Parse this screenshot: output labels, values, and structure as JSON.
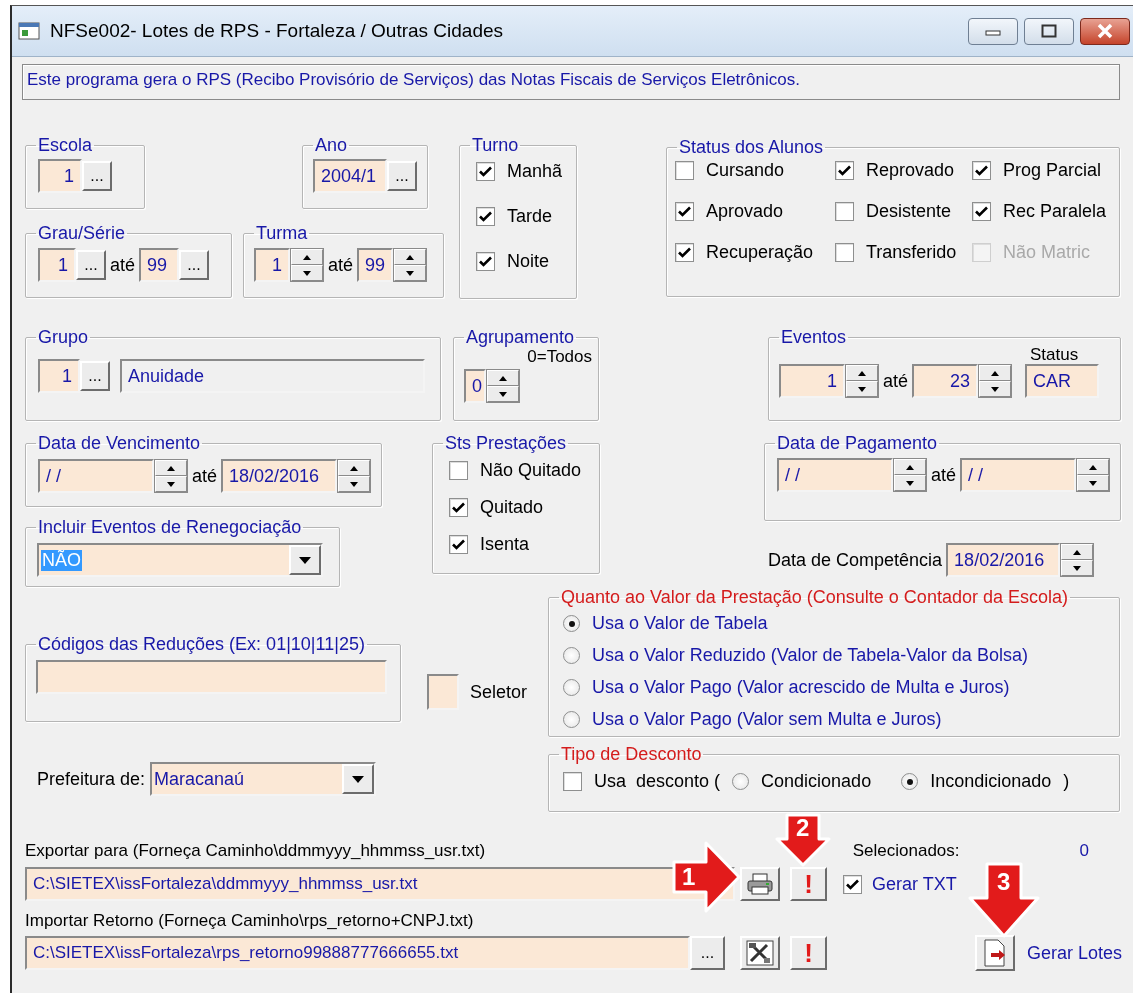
{
  "window": {
    "title": "NFSe002- Lotes de RPS - Fortaleza / Outras Cidades"
  },
  "description": "Este programa gera o RPS (Recibo Provisório de Serviços) das Notas Fiscais de Serviços Eletrônicos.",
  "escola": {
    "label": "Escola",
    "value": "1",
    "button": "..."
  },
  "ano": {
    "label": "Ano",
    "value": "2004/1",
    "button": "..."
  },
  "grau_serie": {
    "label": "Grau/Série",
    "from": "1",
    "from_button": "...",
    "to_label": "até",
    "to": "99",
    "to_button": "..."
  },
  "turma": {
    "label": "Turma",
    "from": "1",
    "to_label": "até",
    "to": "99"
  },
  "turno": {
    "label": "Turno",
    "options": [
      {
        "label": "Manhã",
        "checked": true
      },
      {
        "label": "Tarde",
        "checked": true
      },
      {
        "label": "Noite",
        "checked": true
      }
    ]
  },
  "status_alunos": {
    "label": "Status dos Alunos",
    "options": [
      {
        "label": "Cursando",
        "checked": false,
        "disabled": false
      },
      {
        "label": "Reprovado",
        "checked": true,
        "disabled": false
      },
      {
        "label": "Prog Parcial",
        "checked": true,
        "disabled": false
      },
      {
        "label": "Aprovado",
        "checked": true,
        "disabled": false
      },
      {
        "label": "Desistente",
        "checked": false,
        "disabled": false
      },
      {
        "label": "Rec Paralela",
        "checked": true,
        "disabled": false
      },
      {
        "label": "Recuperação",
        "checked": true,
        "disabled": false
      },
      {
        "label": "Transferido",
        "checked": false,
        "disabled": false
      },
      {
        "label": "Não Matric",
        "checked": false,
        "disabled": true
      }
    ]
  },
  "grupo": {
    "label": "Grupo",
    "code": "1",
    "button": "...",
    "name": "Anuidade"
  },
  "agrupamento": {
    "label": "Agrupamento",
    "hint": "0=Todos",
    "value": "0"
  },
  "eventos": {
    "label": "Eventos",
    "from": "1",
    "to_label": "até",
    "to": "23",
    "status_label": "Status",
    "status": "CAR"
  },
  "data_vencimento": {
    "label": "Data de Vencimento",
    "from": "/ /",
    "to_label": "até",
    "to": "18/02/2016"
  },
  "sts_prestacoes": {
    "label": "Sts Prestações",
    "options": [
      {
        "label": "Não Quitado",
        "checked": false
      },
      {
        "label": "Quitado",
        "checked": true
      },
      {
        "label": "Isenta",
        "checked": true
      }
    ]
  },
  "data_pagamento": {
    "label": "Data de Pagamento",
    "from": "/ /",
    "to_label": "até",
    "to": "/ /"
  },
  "data_competencia": {
    "label": "Data de Competência",
    "value": "18/02/2016"
  },
  "renegociacao": {
    "label": "Incluir Eventos de Renegociação",
    "value": "NÃO",
    "highlighted": true
  },
  "codigos_reducoes": {
    "label": "Códigos das Reduções (Ex: 01|10|11|25)"
  },
  "seletor": {
    "label": "Seletor"
  },
  "valor_prestacao": {
    "label": "Quanto ao Valor da Prestação (Consulte o Contador da Escola)",
    "options": [
      {
        "label": "Usa o Valor de Tabela",
        "selected": true
      },
      {
        "label": "Usa o Valor Reduzido (Valor de Tabela-Valor da Bolsa)",
        "selected": false
      },
      {
        "label": "Usa o Valor Pago (Valor acrescido de Multa e Juros)",
        "selected": false
      },
      {
        "label": "Usa o Valor Pago (Valor sem Multa e Juros)",
        "selected": false
      }
    ]
  },
  "prefeitura": {
    "label": "Prefeitura de:",
    "value": "Maracanaú"
  },
  "tipo_desconto": {
    "label": "Tipo de Desconto",
    "checkbox": {
      "label": "Usa  desconto (",
      "checked": false
    },
    "options": [
      {
        "label": "Condicionado",
        "selected": false
      },
      {
        "label": "Incondicionado",
        "selected": true
      }
    ],
    "close": ")"
  },
  "selecionados": {
    "label": "Selecionados:",
    "value": "0"
  },
  "exportar": {
    "label": "Exportar para (Forneça Caminho\\ddmmyyy_hhmmss_usr.txt)",
    "path": "C:\\SIETEX\\issFortaleza\\ddmmyyy_hhmmss_usr.txt",
    "alert_button": "!"
  },
  "gerar_txt": {
    "label": "Gerar TXT",
    "checked": true
  },
  "importar": {
    "label": "Importar Retorno (Forneça Caminho\\rps_retorno+CNPJ.txt)",
    "path": "C:\\SIETEX\\issFortaleza\\rps_retorno99888777666655.txt",
    "button": "...",
    "alert_button": "!"
  },
  "gerar_lotes": {
    "label": "Gerar Lotes"
  },
  "callouts": [
    {
      "number": "1",
      "kind": "right"
    },
    {
      "number": "2",
      "kind": "down"
    },
    {
      "number": "3",
      "kind": "down"
    }
  ]
}
